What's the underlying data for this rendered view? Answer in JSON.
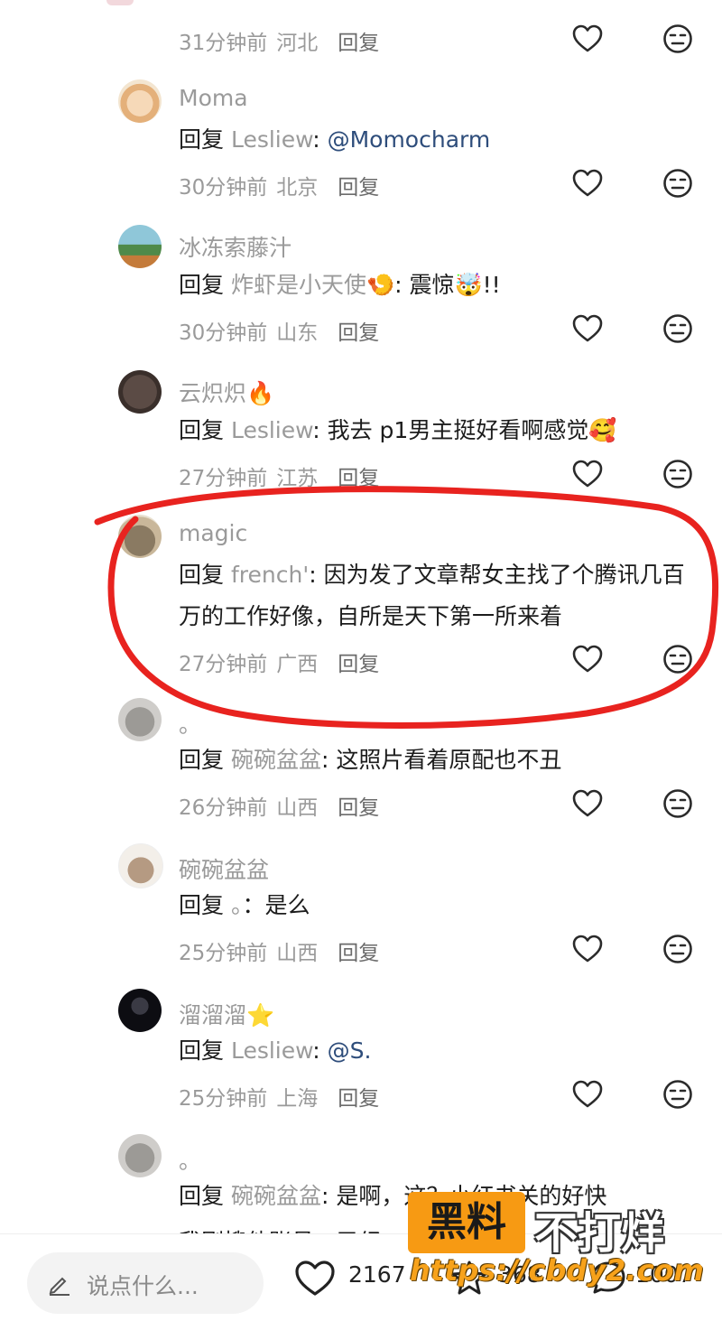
{
  "comments": [
    {
      "id": "c0",
      "username": "",
      "meta": {
        "time": "31分钟前",
        "location": "河北",
        "reply": "回复"
      }
    },
    {
      "id": "c1",
      "username": "Moma",
      "body": {
        "reply": "回复",
        "target": "Lesliew",
        "sep": ": ",
        "mention": "@Momocharm",
        "text": ""
      },
      "meta": {
        "time": "30分钟前",
        "location": "北京",
        "reply": "回复"
      }
    },
    {
      "id": "c2",
      "username": "冰冻索藤汁",
      "body": {
        "reply": "回复",
        "target": "炸虾是小天使🍤",
        "sep": ": ",
        "text": "震惊🤯!!"
      },
      "meta": {
        "time": "30分钟前",
        "location": "山东",
        "reply": "回复"
      }
    },
    {
      "id": "c3",
      "username": "云炽炽🔥",
      "body": {
        "reply": "回复",
        "target": "Lesliew",
        "sep": ": ",
        "text": "我去 p1男主挺好看啊感觉🥰"
      },
      "meta": {
        "time": "27分钟前",
        "location": "江苏",
        "reply": "回复"
      }
    },
    {
      "id": "c4",
      "username": "magic",
      "body": {
        "reply": "回复",
        "target": "french'",
        "sep": ": ",
        "text": "因为发了文章帮女主找了个腾讯几百万的工作好像，自所是天下第一所来着"
      },
      "meta": {
        "time": "27分钟前",
        "location": "广西",
        "reply": "回复"
      }
    },
    {
      "id": "c5",
      "username": "。",
      "body": {
        "reply": "回复",
        "target": "碗碗盆盆",
        "sep": ": ",
        "text": "这照片看着原配也不丑"
      },
      "meta": {
        "time": "26分钟前",
        "location": "山西",
        "reply": "回复"
      }
    },
    {
      "id": "c6",
      "username": "碗碗盆盆",
      "body": {
        "reply": "回复",
        "target": "。",
        "sep": "：",
        "text": "是么"
      },
      "meta": {
        "time": "25分钟前",
        "location": "山西",
        "reply": "回复"
      }
    },
    {
      "id": "c7",
      "username": "溜溜溜⭐",
      "body": {
        "reply": "回复",
        "target": "Lesliew",
        "sep": ": ",
        "mention": "@S.",
        "text": ""
      },
      "meta": {
        "time": "25分钟前",
        "location": "上海",
        "reply": "回复"
      }
    },
    {
      "id": "c8",
      "username": "。",
      "body": {
        "reply": "回复",
        "target": "碗碗盆盆",
        "sep": ": ",
        "text": "是啊，这？小红书关的好快"
      }
    }
  ],
  "cutoff_line": "我刚搜他账号，已经",
  "bottom_bar": {
    "placeholder": "说点什么...",
    "likes": "2167",
    "collects": "368",
    "comments": "1007"
  },
  "watermark": {
    "box": "黑料",
    "text": "不打烊",
    "url": "https://cbdy2.com"
  },
  "colors": {
    "accent_link": "#2e4d7b",
    "muted": "#9a9a9a",
    "highlight": "#e8231f",
    "watermark": "#f79a13"
  }
}
